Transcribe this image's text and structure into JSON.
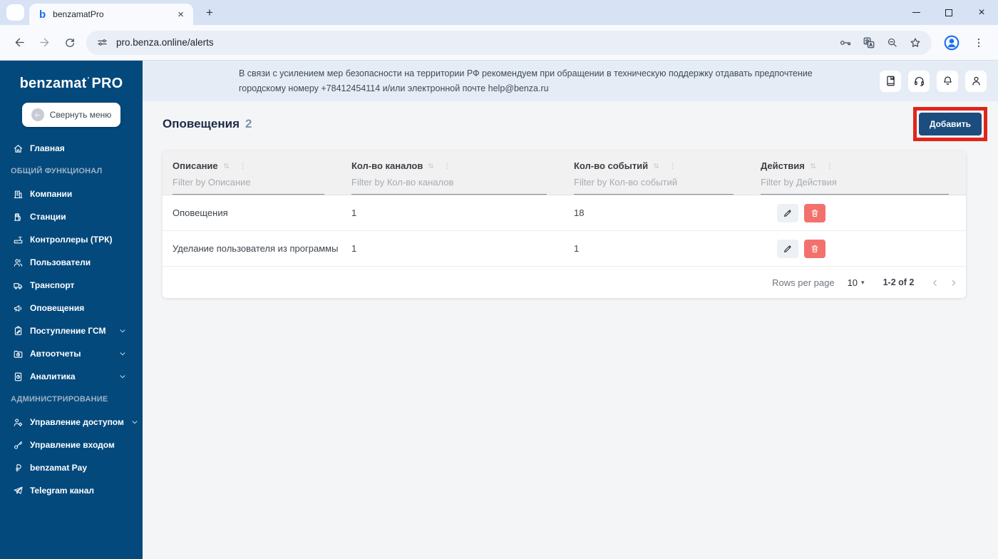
{
  "browser": {
    "tab_title": "benzamatPro",
    "favicon_letter": "b",
    "url": "pro.benza.online/alerts"
  },
  "banner": {
    "line1": "В связи с усилением мер безопасности на территории РФ рекомендуем при обращении в техническую поддержку отдавать предпочтение",
    "line2": "городскому номеру +78412454114 и/или электронной почте help@benza.ru"
  },
  "header_actions": [
    {
      "icon": "manual-icon"
    },
    {
      "icon": "support-icon"
    },
    {
      "icon": "notifications-icon"
    },
    {
      "icon": "profile-icon"
    }
  ],
  "sidebar": {
    "logo": {
      "brand": "benzamat",
      "mark": "’",
      "suffix": "PRO"
    },
    "collapse_label": "Свернуть меню",
    "items": [
      {
        "icon": "home-icon",
        "label": "Главная"
      },
      {
        "section": "ОБЩИЙ ФУНКЦИОНАЛ"
      },
      {
        "icon": "companies-icon",
        "label": "Компании"
      },
      {
        "icon": "stations-icon",
        "label": "Станции"
      },
      {
        "icon": "controllers-icon",
        "label": "Контроллеры (ТРК)"
      },
      {
        "icon": "users-icon",
        "label": "Пользователи"
      },
      {
        "icon": "transport-icon",
        "label": "Транспорт"
      },
      {
        "icon": "alerts-icon",
        "label": "Оповещения"
      },
      {
        "icon": "fuel-income-icon",
        "label": "Поступление ГСМ",
        "expandable": true
      },
      {
        "icon": "autoreports-icon",
        "label": "Автоотчеты",
        "expandable": true
      },
      {
        "icon": "analytics-icon",
        "label": "Аналитика",
        "expandable": true
      },
      {
        "section": "АДМИНИСТРИРОВАНИЕ"
      },
      {
        "icon": "access-icon",
        "label": "Управление доступом",
        "expandable": true
      },
      {
        "icon": "login-icon",
        "label": "Управление входом"
      },
      {
        "icon": "pay-icon",
        "label": "benzamat Pay"
      },
      {
        "icon": "telegram-icon",
        "label": "Telegram канал"
      }
    ]
  },
  "main": {
    "title": "Оповещения",
    "count": "2",
    "add_button_label": "Добавить",
    "table": {
      "columns": [
        {
          "label": "Описание",
          "filter_placeholder": "Filter by Описание"
        },
        {
          "label": "Кол-во каналов",
          "filter_placeholder": "Filter by Кол-во каналов"
        },
        {
          "label": "Кол-во событий",
          "filter_placeholder": "Filter by Кол-во событий"
        },
        {
          "label": "Действия",
          "filter_placeholder": "Filter by Действия"
        }
      ],
      "rows": [
        {
          "description": "Оповещения",
          "channels": "1",
          "events": "18",
          "actions": [
            "edit-pencil-icon",
            "delete-trash-icon"
          ]
        },
        {
          "description": "Уделание пользователя из программы",
          "channels": "1",
          "events": "1",
          "actions": [
            "edit-pencil-icon",
            "delete-trash-icon"
          ]
        }
      ],
      "pagination": {
        "rows_per_page_label": "Rows per page",
        "rows_per_page_value": "10",
        "range": "1-2 of 2"
      }
    }
  },
  "colors": {
    "sidebar": "#03497c",
    "accent_button": "#1b4d7f",
    "annotation_highlight": "#e1251b",
    "delete_button": "#f3716d"
  }
}
